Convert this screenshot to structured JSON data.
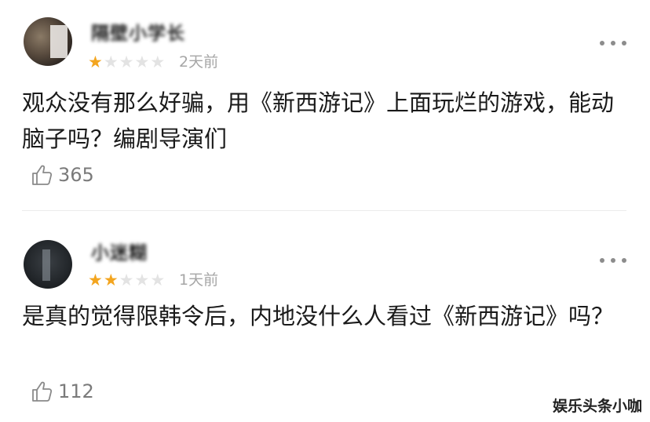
{
  "comments": [
    {
      "username": "隔壁小学长",
      "rating": 1,
      "max_rating": 5,
      "time": "2天前",
      "text": "观众没有那么好骗，用《新西游记》上面玩烂的游戏，能动脑子吗？编剧导演们",
      "likes": "365"
    },
    {
      "username": "小迷糊",
      "rating": 2,
      "max_rating": 5,
      "time": "1天前",
      "text": "是真的觉得限韩令后，内地没什么人看过《新西游记》吗？",
      "likes": "112"
    }
  ],
  "icons": {
    "star": "star-icon",
    "more": "more-dots-icon",
    "like": "thumbs-up-icon"
  },
  "colors": {
    "star_on": "#f3a51f",
    "star_off": "#e3e3e3",
    "muted": "#a6a6a6"
  },
  "watermark": "娱乐头条小咖"
}
